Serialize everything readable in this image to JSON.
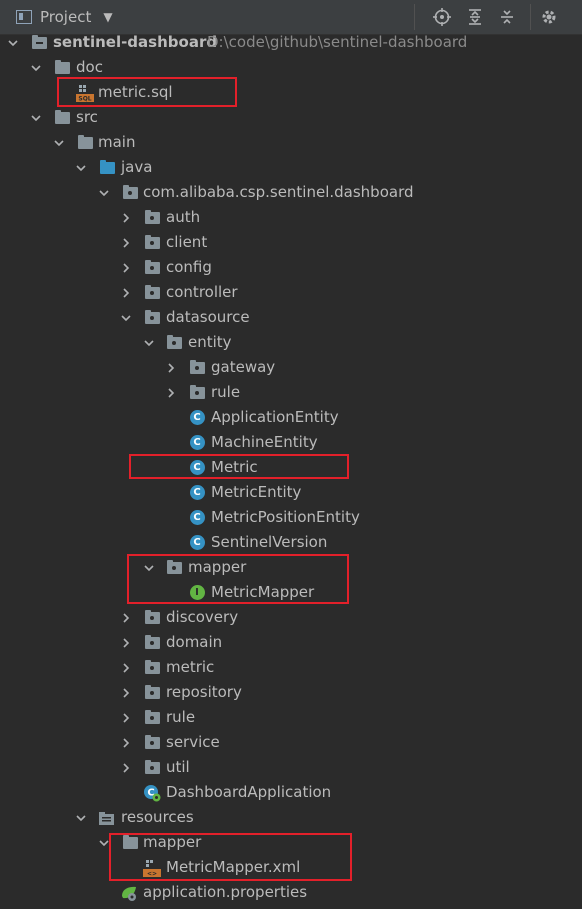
{
  "toolbar": {
    "title": "Project",
    "icons": [
      "locate-icon",
      "expand-all-icon",
      "collapse-all-icon",
      "gear-icon"
    ]
  },
  "colors": {
    "highlight_box": "#e3202a",
    "class_icon": "#3592c4",
    "interface_icon": "#62b543",
    "source_folder": "#3592c4"
  },
  "tree": {
    "root": {
      "name": "sentinel-dashboard",
      "path": "D:\\code\\github\\sentinel-dashboard"
    },
    "items": [
      {
        "label": "doc"
      },
      {
        "label": "metric.sql"
      },
      {
        "label": "src"
      },
      {
        "label": "main"
      },
      {
        "label": "java"
      },
      {
        "label": "com.alibaba.csp.sentinel.dashboard"
      },
      {
        "label": "auth"
      },
      {
        "label": "client"
      },
      {
        "label": "config"
      },
      {
        "label": "controller"
      },
      {
        "label": "datasource"
      },
      {
        "label": "entity"
      },
      {
        "label": "gateway"
      },
      {
        "label": "rule"
      },
      {
        "label": "ApplicationEntity"
      },
      {
        "label": "MachineEntity"
      },
      {
        "label": "Metric"
      },
      {
        "label": "MetricEntity"
      },
      {
        "label": "MetricPositionEntity"
      },
      {
        "label": "SentinelVersion"
      },
      {
        "label": "mapper"
      },
      {
        "label": "MetricMapper"
      },
      {
        "label": "discovery"
      },
      {
        "label": "domain"
      },
      {
        "label": "metric"
      },
      {
        "label": "repository"
      },
      {
        "label": "rule"
      },
      {
        "label": "service"
      },
      {
        "label": "util"
      },
      {
        "label": "DashboardApplication"
      },
      {
        "label": "resources"
      },
      {
        "label": "mapper"
      },
      {
        "label": "MetricMapper.xml"
      },
      {
        "label": "application.properties"
      }
    ]
  }
}
